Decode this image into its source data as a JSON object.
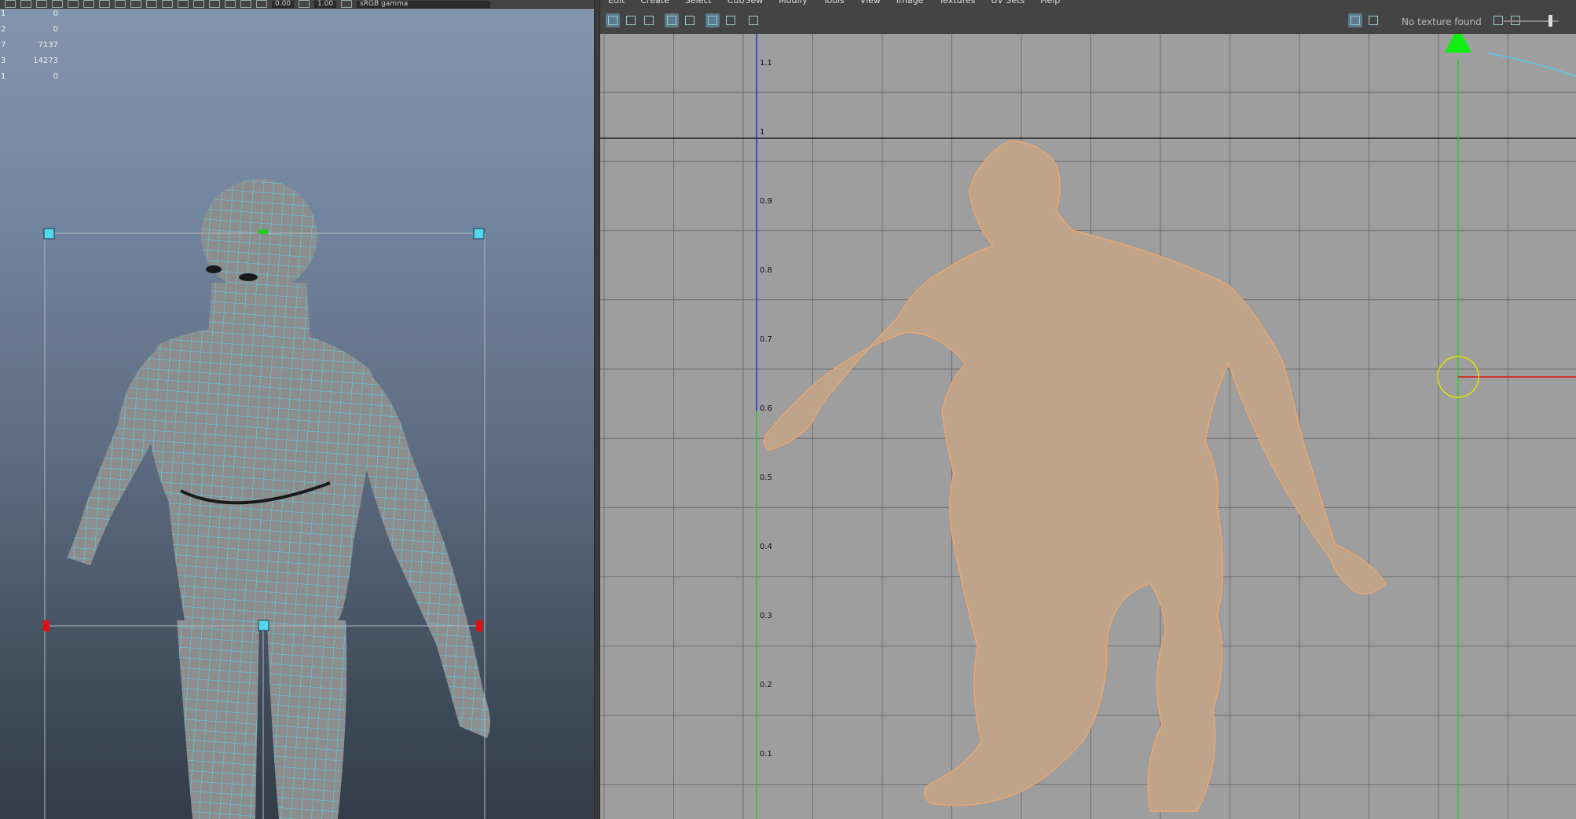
{
  "left_viewport": {
    "toolbar": {
      "field_a": "0.00",
      "field_b": "1.00",
      "color_mgmt": "sRGB gamma"
    },
    "hud": [
      {
        "key": "1",
        "value": "0"
      },
      {
        "key": "2",
        "value": "0"
      },
      {
        "key": "7",
        "value": "7137"
      },
      {
        "key": "3",
        "value": "14273"
      },
      {
        "key": "1",
        "value": "0"
      }
    ],
    "wire_color": "#4fd8f0",
    "mesh_color": "#8d8d8d"
  },
  "uv_editor": {
    "menu": [
      "Edit",
      "Create",
      "Select",
      "Cut/Sew",
      "Modify",
      "Tools",
      "View",
      "Image",
      "Textures",
      "UV Sets",
      "Help"
    ],
    "texture_status": "No texture found",
    "wire_color": "#f2a66c",
    "grid_bg": "#9e9e9e",
    "axis_ticks": [
      "1.1",
      "1",
      "0.9",
      "0.8",
      "0.7",
      "0.6",
      "0.5",
      "0.4",
      "0.3",
      "0.2",
      "0.1"
    ],
    "icons": [
      "uv-shell-icon",
      "uv-layout-icon",
      "uv-tile-icon",
      "grid-toggle-icon",
      "grid-options-icon",
      "checker-icon",
      "wireframe-icon",
      "shaded-icon",
      "snapshot-icon",
      "image-display-icon",
      "checker-pattern-icon",
      "uv-sync-icon",
      "texture-toggle-icon"
    ]
  }
}
